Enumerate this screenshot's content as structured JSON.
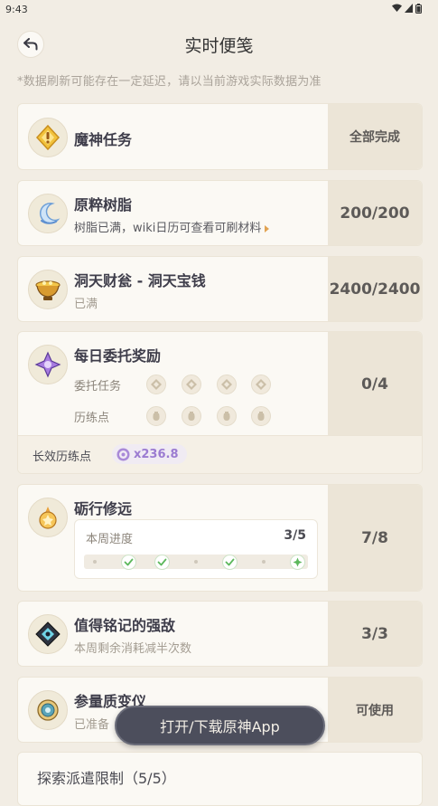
{
  "status_bar": {
    "time": "9:43"
  },
  "header": {
    "title": "实时便笺"
  },
  "notice": "*数据刷新可能存在一定延迟，请以当前游戏实际数据为准",
  "cards": {
    "weekly_boss_task": {
      "title": "魔神任务",
      "value": "全部完成"
    },
    "resin": {
      "title": "原粹树脂",
      "subtitle": "树脂已满，wiki日历可查看可刷材料",
      "value": "200/200"
    },
    "realm_currency": {
      "title": "洞天财瓮 - 洞天宝钱",
      "subtitle": "已满",
      "value": "2400/2400"
    },
    "daily_commission": {
      "title": "每日委托奖励",
      "commission_label": "委托任务",
      "points_label": "历练点",
      "value": "0/4",
      "long_term_label": "长效历练点",
      "long_term_value": "x236.8"
    },
    "encounter_points": {
      "title": "砺行修远",
      "weekly_progress_label": "本周进度",
      "weekly_progress_value": "3/5",
      "weekly_checkpoints": [
        false,
        true,
        true,
        false,
        true,
        false,
        true
      ],
      "value": "7/8"
    },
    "weekly_boss_discount": {
      "title": "值得铭记的强敌",
      "subtitle": "本周剩余消耗减半次数",
      "value": "3/3"
    },
    "transformer": {
      "title": "参量质变仪",
      "subtitle": "已准备",
      "value": "可使用"
    }
  },
  "toast": {
    "label": "打开/下载原神App"
  },
  "expedition": {
    "title": "探索派遣限制（5/5）"
  },
  "colors": {
    "background": "#f2ede4",
    "card": "#fbf9f4",
    "value_panel": "#ece5d7",
    "accent": "#e1a352",
    "check": "#5cb85c",
    "badge_purple": "#9b7bd1"
  }
}
